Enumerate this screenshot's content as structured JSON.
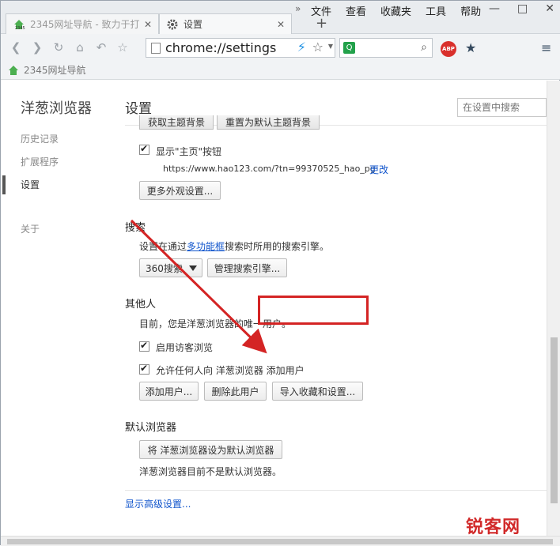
{
  "tabs": [
    {
      "title": "2345网址导航 - 致力于打",
      "close": "✕"
    },
    {
      "title": "设置",
      "close": "✕"
    }
  ],
  "tab_overflow": "»",
  "new_tab": "+",
  "menu": [
    "文件",
    "查看",
    "收藏夹",
    "工具",
    "帮助"
  ],
  "window_controls": [
    "—",
    "□",
    "✕"
  ],
  "address": {
    "url": "chrome://settings"
  },
  "extensions": {
    "abp": "ABP"
  },
  "bookmarks": [
    {
      "label": "2345网址导航"
    }
  ],
  "sidebar": {
    "brand": "洋葱浏览器",
    "items": [
      {
        "label": "历史记录"
      },
      {
        "label": "扩展程序"
      },
      {
        "label": "设置"
      },
      {
        "label": "关于"
      }
    ]
  },
  "page": {
    "title": "设置",
    "search_placeholder": "在设置中搜索"
  },
  "appearance": {
    "cut_buttons": [
      "获取主题背景",
      "重置为默认主题背景"
    ],
    "show_home_label": "显示\"主页\"按钮",
    "home_url": "https://www.hao123.com/?tn=99370525_hao_pg",
    "change_link": "更改",
    "more_button": "更多外观设置..."
  },
  "search": {
    "title": "搜索",
    "desc_before": "设置在通过",
    "desc_link": "多功能框",
    "desc_after": "搜索时所用的搜索引擎。",
    "engine": "360搜索",
    "manage_button": "管理搜索引擎..."
  },
  "people": {
    "title": "其他人",
    "desc": "目前，您是洋葱浏览器的唯一用户。",
    "guest_label": "启用访客浏览",
    "allow_label": "允许任何人向 洋葱浏览器 添加用户",
    "add_button": "添加用户...",
    "delete_button": "删除此用户",
    "import_button": "导入收藏和设置..."
  },
  "default_browser": {
    "title": "默认浏览器",
    "set_button": "将 洋葱浏览器设为默认浏览器",
    "status": "洋葱浏览器目前不是默认浏览器。"
  },
  "advanced_link": "显示高级设置...",
  "watermark": "锐客网",
  "colors": {
    "accent_red": "#d42424",
    "link": "#1155cc"
  }
}
